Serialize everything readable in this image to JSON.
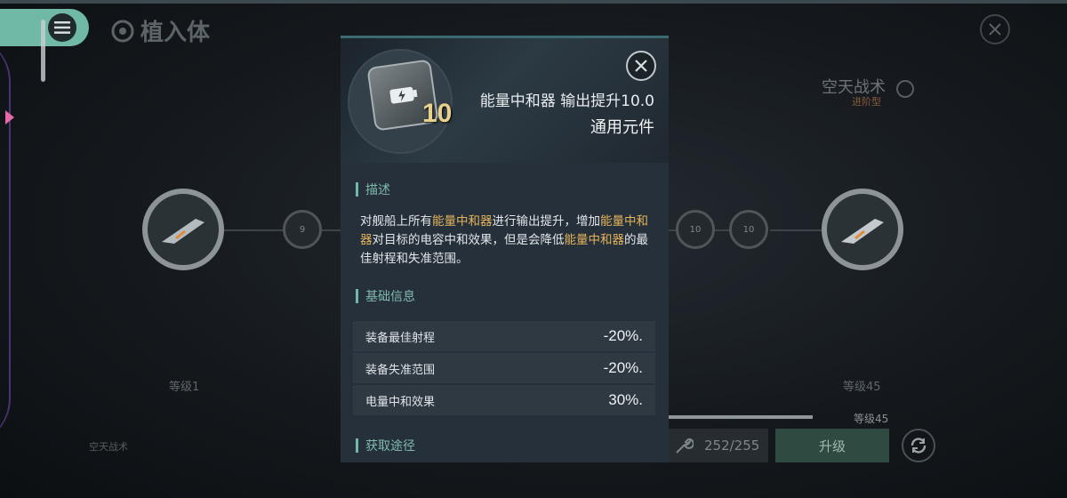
{
  "page": {
    "title": "植入体"
  },
  "background": {
    "left_node_level": "等级1",
    "right_node_level": "等级45",
    "small_node_left": "9",
    "small_node_mid": "10",
    "small_node_right": "10",
    "tactic_name": "空天战术",
    "tactic_subtitle": "进阶型",
    "progress_label": "等级45",
    "progress_fraction": 1.0,
    "bottom_left_label": "空天战术",
    "resource_value": "252/255",
    "upgrade_label": "升级"
  },
  "popup": {
    "item_level": "10",
    "item_name": "能量中和器 输出提升10.0",
    "item_type": "通用元件",
    "desc_header": "描述",
    "desc_parts": {
      "p1": "对舰船上所有",
      "h1": "能量中和器",
      "p2": "进行输出提升，增加",
      "h2": "能量中和器",
      "p3": "对目标的电容中和效果，但是会降低",
      "h3": "能量中和器",
      "p4": "的最佳射程和失准范围。"
    },
    "info_header": "基础信息",
    "stats": [
      {
        "label": "装备最佳射程",
        "value": "-20%."
      },
      {
        "label": "装备失准范围",
        "value": "-20%."
      },
      {
        "label": "电量中和效果",
        "value": "30%."
      }
    ],
    "source_header": "获取途径"
  },
  "colors": {
    "accent": "#6fb9a6",
    "highlight": "#e4b45c",
    "popup_bg": "#26303a"
  },
  "icons": {
    "menu": "menu-icon",
    "close": "close-icon",
    "wrench": "wrench-icon",
    "refresh": "refresh-icon",
    "ship": "ship-icon",
    "battery": "battery-icon"
  }
}
